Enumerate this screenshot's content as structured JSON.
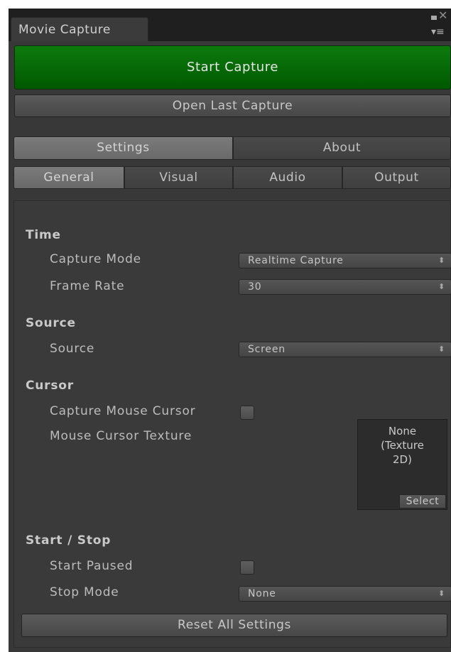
{
  "window": {
    "tab_title": "Movie Capture",
    "icons": [
      "maximize-icon",
      "close-icon",
      "menu-icon"
    ]
  },
  "actions": {
    "start_capture": "Start Capture",
    "open_last_capture": "Open Last Capture"
  },
  "tabs": [
    {
      "label": "Settings",
      "active": true
    },
    {
      "label": "About",
      "active": false
    }
  ],
  "subtabs": [
    {
      "label": "General",
      "active": true
    },
    {
      "label": "Visual",
      "active": false
    },
    {
      "label": "Audio",
      "active": false
    },
    {
      "label": "Output",
      "active": false
    }
  ],
  "time": {
    "header": "Time",
    "capture_mode_label": "Capture Mode",
    "capture_mode_value": "Realtime Capture",
    "frame_rate_label": "Frame Rate",
    "frame_rate_value": "30"
  },
  "source": {
    "header": "Source",
    "source_label": "Source",
    "source_value": "Screen"
  },
  "cursor": {
    "header": "Cursor",
    "capture_mouse_cursor_label": "Capture Mouse Cursor",
    "capture_mouse_cursor_checked": false,
    "mouse_cursor_texture_label": "Mouse Cursor Texture",
    "texture_value": "None\n(Texture\n2D)",
    "select_label": "Select"
  },
  "start_stop": {
    "header": "Start / Stop",
    "start_paused_label": "Start Paused",
    "start_paused_checked": false,
    "stop_mode_label": "Stop Mode",
    "stop_mode_value": "None"
  },
  "footer": {
    "reset_label": "Reset All Settings"
  },
  "colors": {
    "start_button": "#007000",
    "background": "#383838",
    "text": "#bdbdbd"
  }
}
